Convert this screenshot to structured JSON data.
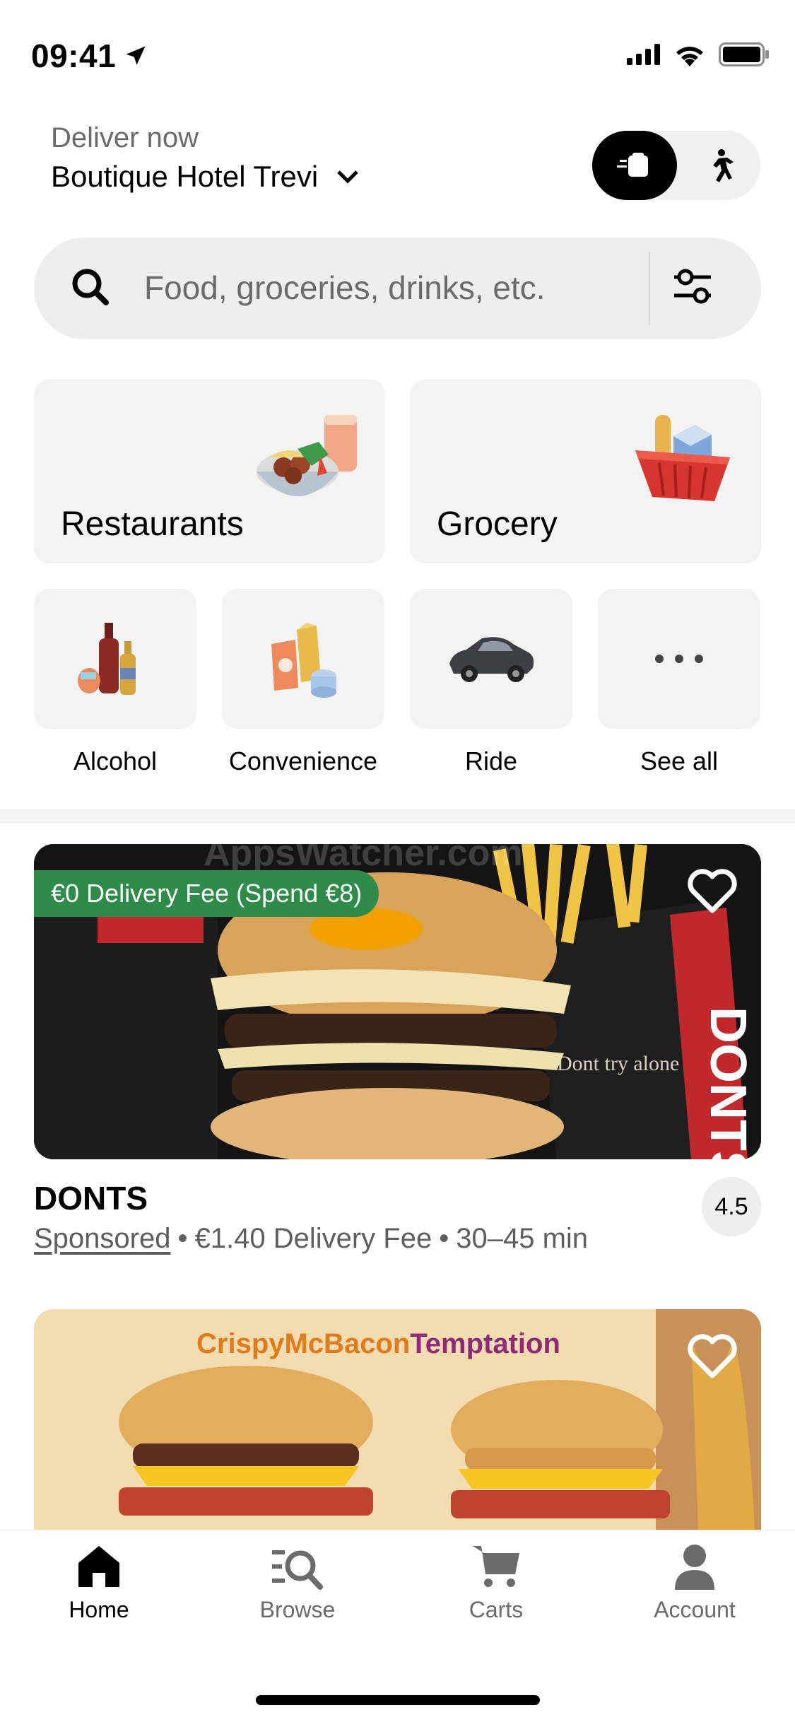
{
  "status_bar": {
    "time": "09:41",
    "location_icon": "location-arrow-icon",
    "signal_icon": "cellular-signal-icon",
    "wifi_icon": "wifi-icon",
    "battery_icon": "battery-icon"
  },
  "header": {
    "deliver_label": "Deliver now",
    "address": "Boutique Hotel Trevi",
    "mode_toggle": {
      "active": "delivery",
      "delivery_icon": "delivery-bag-icon",
      "pickup_icon": "walking-person-icon"
    }
  },
  "search": {
    "placeholder": "Food, groceries, drinks, etc.",
    "value": "",
    "filter_icon": "sliders-icon"
  },
  "categories": {
    "big": [
      {
        "label": "Restaurants",
        "icon": "food-bowl-icon"
      },
      {
        "label": "Grocery",
        "icon": "grocery-basket-icon"
      }
    ],
    "small": [
      {
        "label": "Alcohol",
        "icon": "bottles-icon"
      },
      {
        "label": "Convenience",
        "icon": "convenience-bags-icon"
      },
      {
        "label": "Ride",
        "icon": "car-icon"
      },
      {
        "label": "See all",
        "icon": "more-dots-icon"
      }
    ]
  },
  "stores": [
    {
      "name": "DONTS",
      "promo": "€0 Delivery Fee (Spend €8)",
      "sponsored": "Sponsored",
      "delivery_fee": "€1.40 Delivery Fee",
      "eta": "30–45 min",
      "rating": "4.5",
      "image_text": "DONTS",
      "image_slogan": "Dont try alone",
      "watermark": "AppsWatcher.com",
      "colors": {
        "bg": "#141414",
        "accent": "#c0282c"
      }
    },
    {
      "name": "",
      "image_title_1": "CrispyMcBacon",
      "image_title_2": "Temptation",
      "colors": {
        "bg": "#f3dcb0",
        "title_orange": "#e07b1c",
        "title_purple": "#8e2a78"
      }
    }
  ],
  "separator": "•",
  "tab_bar": [
    {
      "label": "Home",
      "icon": "home-icon",
      "active": true
    },
    {
      "label": "Browse",
      "icon": "browse-search-icon",
      "active": false
    },
    {
      "label": "Carts",
      "icon": "cart-icon",
      "active": false
    },
    {
      "label": "Account",
      "icon": "account-person-icon",
      "active": false
    }
  ]
}
